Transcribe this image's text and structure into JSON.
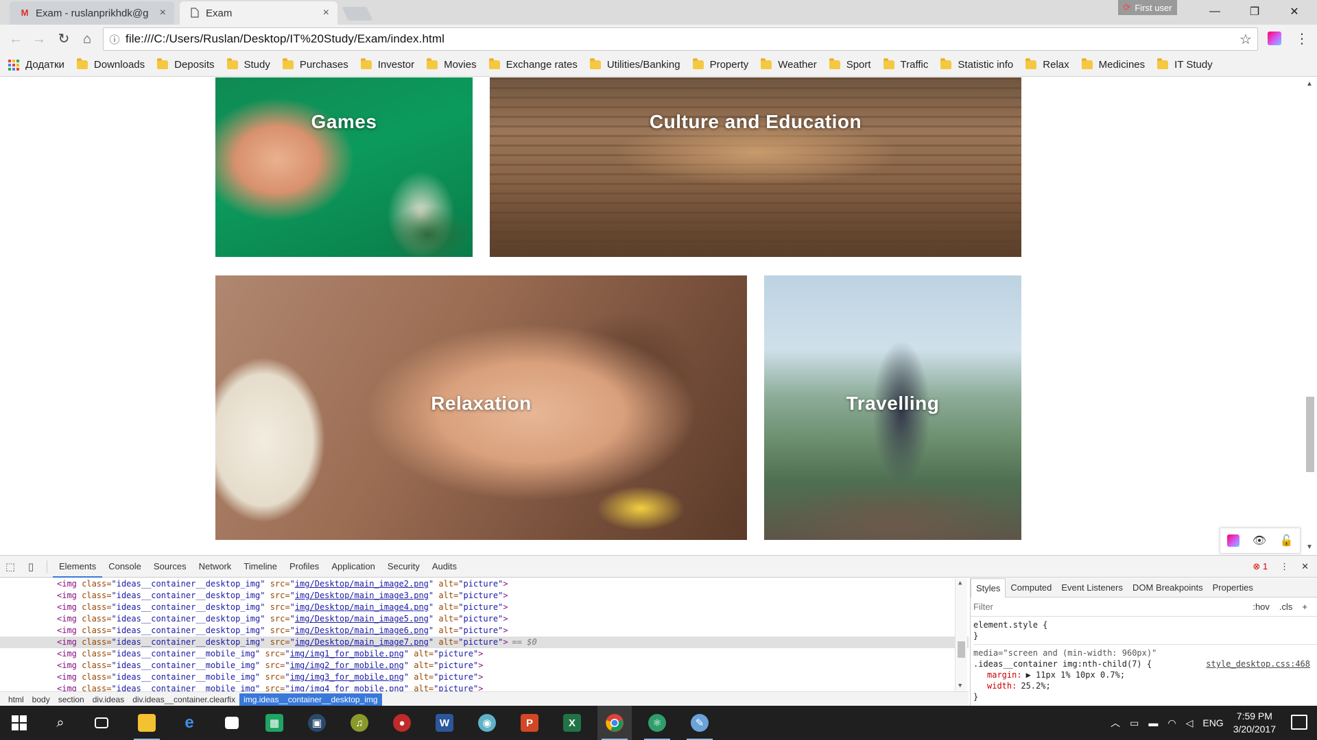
{
  "browser": {
    "tabs": [
      {
        "title": "Exam - ruslanprikhdk@g",
        "icon": "gmail-icon",
        "active": false
      },
      {
        "title": "Exam",
        "icon": "page-icon",
        "active": true
      }
    ],
    "profile_label": "First user",
    "url": "file:///C:/Users/Ruslan/Desktop/IT%20Study/Exam/index.html"
  },
  "bookmarks": {
    "apps_label": "Додатки",
    "items": [
      "Downloads",
      "Deposits",
      "Study",
      "Purchases",
      "Investor",
      "Movies",
      "Exchange rates",
      "Utilities/Banking",
      "Property",
      "Weather",
      "Sport",
      "Traffic",
      "Statistic info",
      "Relax",
      "Medicines",
      "IT Study"
    ]
  },
  "page": {
    "cards": [
      {
        "caption": "Games"
      },
      {
        "caption": "Culture and Education"
      },
      {
        "caption": "Relaxation"
      },
      {
        "caption": "Travelling"
      }
    ]
  },
  "devtools": {
    "tabs": [
      "Elements",
      "Console",
      "Sources",
      "Network",
      "Timeline",
      "Profiles",
      "Application",
      "Security",
      "Audits"
    ],
    "active_tab": "Elements",
    "error_count": "1",
    "code_lines": [
      {
        "tag": "<img",
        "cls": "ideas__container__desktop_img",
        "src": "img/Desktop/main_image2.png",
        "alt": "picture",
        "selected": false
      },
      {
        "tag": "<img",
        "cls": "ideas__container__desktop_img",
        "src": "img/Desktop/main_image3.png",
        "alt": "picture",
        "selected": false
      },
      {
        "tag": "<img",
        "cls": "ideas__container__desktop_img",
        "src": "img/Desktop/main_image4.png",
        "alt": "picture",
        "selected": false
      },
      {
        "tag": "<img",
        "cls": "ideas__container__desktop_img",
        "src": "img/Desktop/main_image5.png",
        "alt": "picture",
        "selected": false
      },
      {
        "tag": "<img",
        "cls": "ideas__container__desktop_img",
        "src": "img/Desktop/main_image6.png",
        "alt": "picture",
        "selected": false
      },
      {
        "tag": "<img",
        "cls": "ideas__container__desktop_img",
        "src": "img/Desktop/main_image7.png",
        "alt": "picture",
        "selected": true
      },
      {
        "tag": "<img",
        "cls": "ideas__container__mobile_img",
        "src": "img/img1_for_mobile.png",
        "alt": "picture",
        "selected": false
      },
      {
        "tag": "<img",
        "cls": "ideas__container__mobile_img",
        "src": "img/img2_for_mobile.png",
        "alt": "picture",
        "selected": false
      },
      {
        "tag": "<img",
        "cls": "ideas__container__mobile_img",
        "src": "img/img3_for_mobile.png",
        "alt": "picture",
        "selected": false
      },
      {
        "tag": "<img",
        "cls": "ideas__container__mobile_img",
        "src": "img/img4_for_mobile.png",
        "alt": "picture",
        "selected": false
      }
    ],
    "selected_marker": "== $0",
    "breadcrumbs": [
      "html",
      "body",
      "section",
      "div.ideas",
      "div.ideas__container.clearfix",
      "img.ideas__container__desktop_img"
    ],
    "styles_tabs": [
      "Styles",
      "Computed",
      "Event Listeners",
      "DOM Breakpoints",
      "Properties"
    ],
    "filter_placeholder": "Filter",
    "filter_hov": ":hov",
    "filter_cls": ".cls",
    "element_style": "element.style {",
    "close_brace": "}",
    "media_query": "media=\"screen and (min-width: 960px)\"",
    "rule_selector": ".ideas__container img:nth-child(7) {",
    "rule_source": "style_desktop.css:468",
    "rule_props": [
      {
        "name": "margin:",
        "value": "▶ 11px 1% 10px 0.7%;"
      },
      {
        "name": "width:",
        "value": "25.2%;"
      }
    ]
  },
  "taskbar": {
    "apps": [
      "start-icon",
      "search-icon",
      "task-view-icon",
      "file-explorer-icon",
      "edge-icon",
      "store-icon",
      "sheets-icon",
      "monitor-icon",
      "itunes-icon",
      "media-icon",
      "word-icon",
      "webcam-icon",
      "powerpoint-icon",
      "excel-icon",
      "chrome-icon",
      "atom-icon",
      "paint-icon"
    ],
    "language": "ENG",
    "time": "7:59 PM",
    "date": "3/20/2017"
  },
  "colors": {
    "accent_blue": "#3879d9",
    "taskbar_bg": "#1f1f1f",
    "folder_yellow": "#f5c842"
  }
}
